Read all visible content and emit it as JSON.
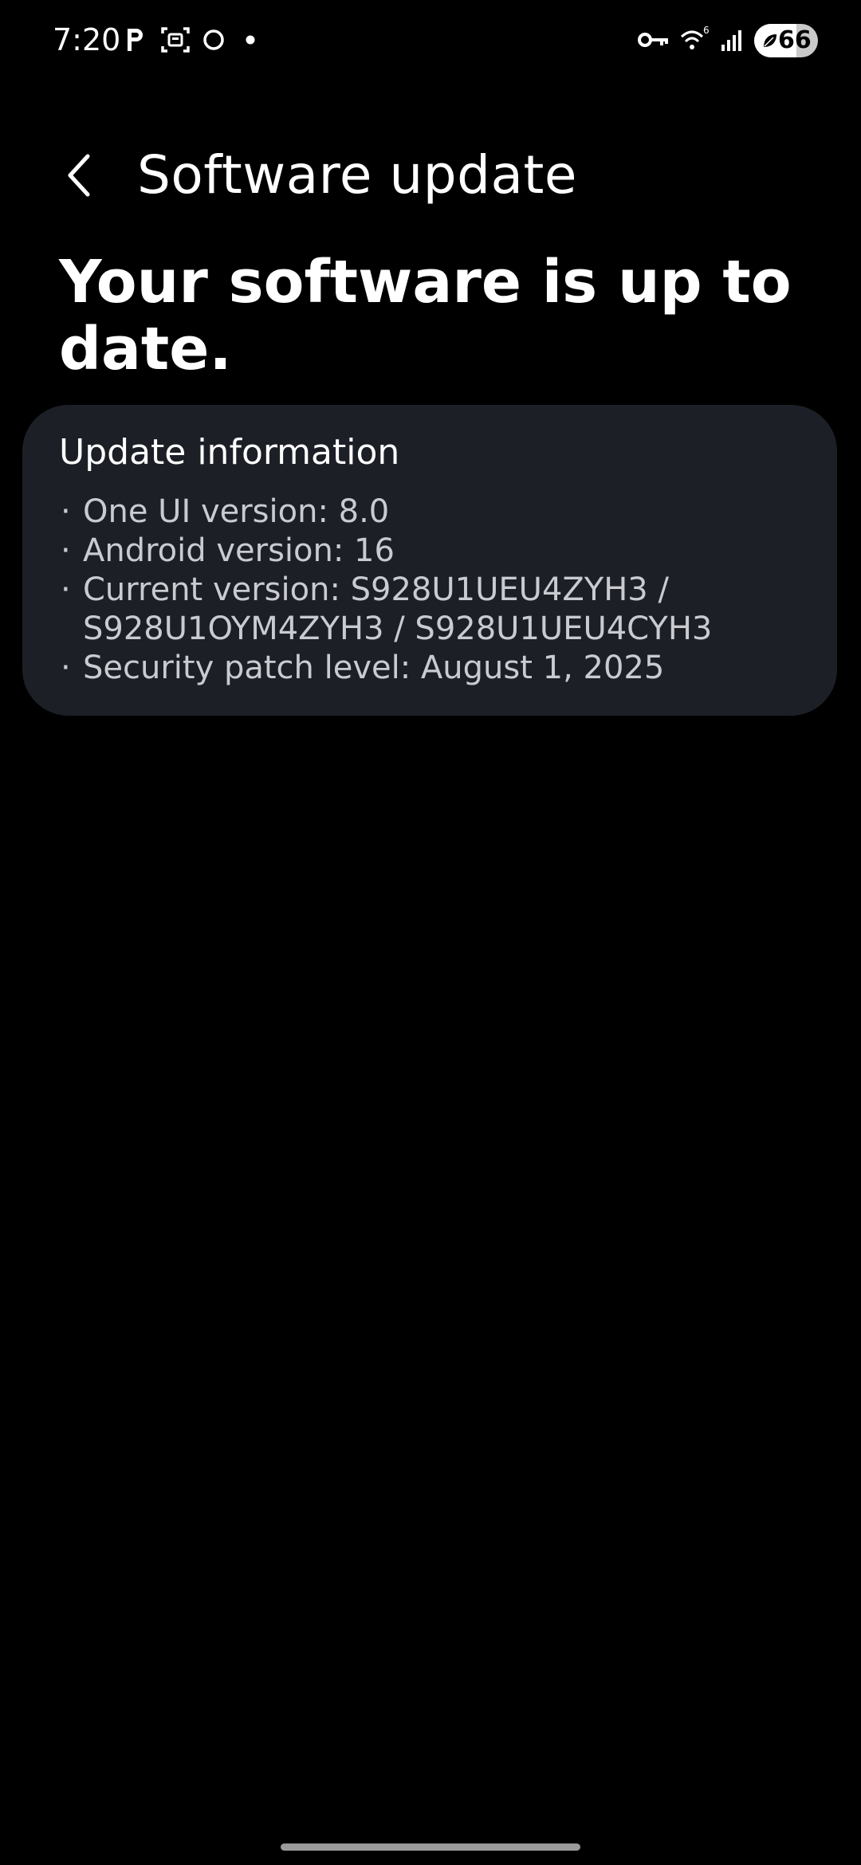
{
  "status_bar": {
    "time": "7:20",
    "left_icons": [
      "parking-icon",
      "screenshot-scan-icon",
      "circle-icon",
      "notification-dot-icon"
    ],
    "right_icons": [
      "vpn-key-icon",
      "wifi-6-icon",
      "signal-bars-icon"
    ],
    "battery_level": "66",
    "battery_fraction": 0.66
  },
  "header": {
    "title": "Software update",
    "back_icon": "chevron-left-icon"
  },
  "headline": "Your software is up to date.",
  "update_info": {
    "title": "Update information",
    "bullet": "·",
    "items": [
      "One UI version: 8.0",
      "Android version: 16",
      "Current version: S928U1UEU4ZYH3 / S928U1OYM4ZYH3 / S928U1UEU4CYH3",
      "Security patch level: August 1, 2025"
    ]
  },
  "colors": {
    "background": "#000000",
    "card_background": "#1c1f26",
    "primary_text": "#ffffff",
    "secondary_text": "#c9cbd0"
  }
}
